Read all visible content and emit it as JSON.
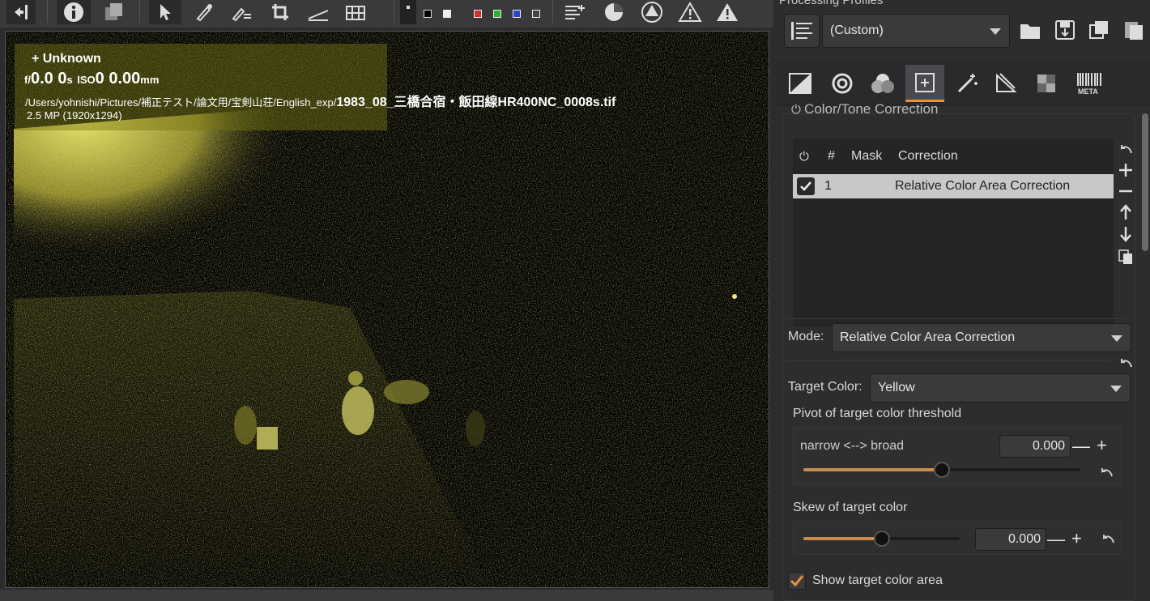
{
  "toolbar": {
    "items": [
      "back-icon",
      "info-icon",
      "copy-icon",
      "pointer-icon",
      "color-picker-icon",
      "picker-list-icon",
      "crop-icon",
      "straighten-icon",
      "grid-icon",
      "before-after-icon",
      "bg-black",
      "bg-white",
      "red-channel",
      "green-channel",
      "blue-channel",
      "luminance-channel",
      "histogram-icon",
      "focus-mask-icon",
      "clip-shadow-icon",
      "warning-icon",
      "warning-filled-icon"
    ]
  },
  "overlay": {
    "name": "+ Unknown",
    "aperture_prefix": "f/",
    "aperture": "0.0",
    "shutter": "0",
    "shutter_unit": "s",
    "iso_label": "ISO",
    "iso": "0",
    "focal": "0.00",
    "focal_unit": "mm",
    "path_prefix": "/Users/yohnishi/Pictures/補正テスト/論文用/宝剣山荘/English_exp/",
    "filename": "1983_08_三橋合宿・飯田線HR400NC_0008s.tif",
    "resolution": "2.5 MP (1920x1294)"
  },
  "panel": {
    "title": "Processing Profiles",
    "profile_value": "(Custom)",
    "section_title": "Color/Tone Correction",
    "list": {
      "headers": {
        "hash": "#",
        "mask": "Mask",
        "correction": "Correction"
      },
      "rows": [
        {
          "index": "1",
          "mask": "",
          "correction": "Relative Color Area Correction",
          "checked": true
        }
      ]
    },
    "mode_label": "Mode:",
    "mode_value": "Relative Color Area Correction",
    "target_label": "Target Color:",
    "target_value": "Yellow",
    "pivot": {
      "title": "Pivot of target color threshold",
      "label": "narrow <--> broad",
      "value": "0.000",
      "level": 0.5
    },
    "skew": {
      "title": "Skew of target color",
      "value": "0.000",
      "level": 0.5
    },
    "show_area_label": "Show target color area",
    "show_area_checked": true
  },
  "colors": {
    "accent": "#e8903c",
    "photo_yellow": "#d8d44a"
  }
}
